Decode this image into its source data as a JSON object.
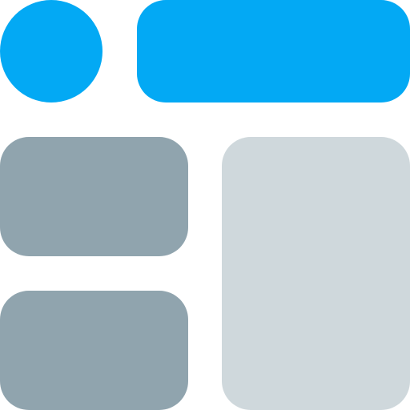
{
  "icon": {
    "semantic_name": "dashboard-layout-icon",
    "colors": {
      "accent": "#03A9F4",
      "dark_block": "#90A4AE",
      "light_panel": "#CFD8DC",
      "background": "#FFFFFF"
    }
  }
}
